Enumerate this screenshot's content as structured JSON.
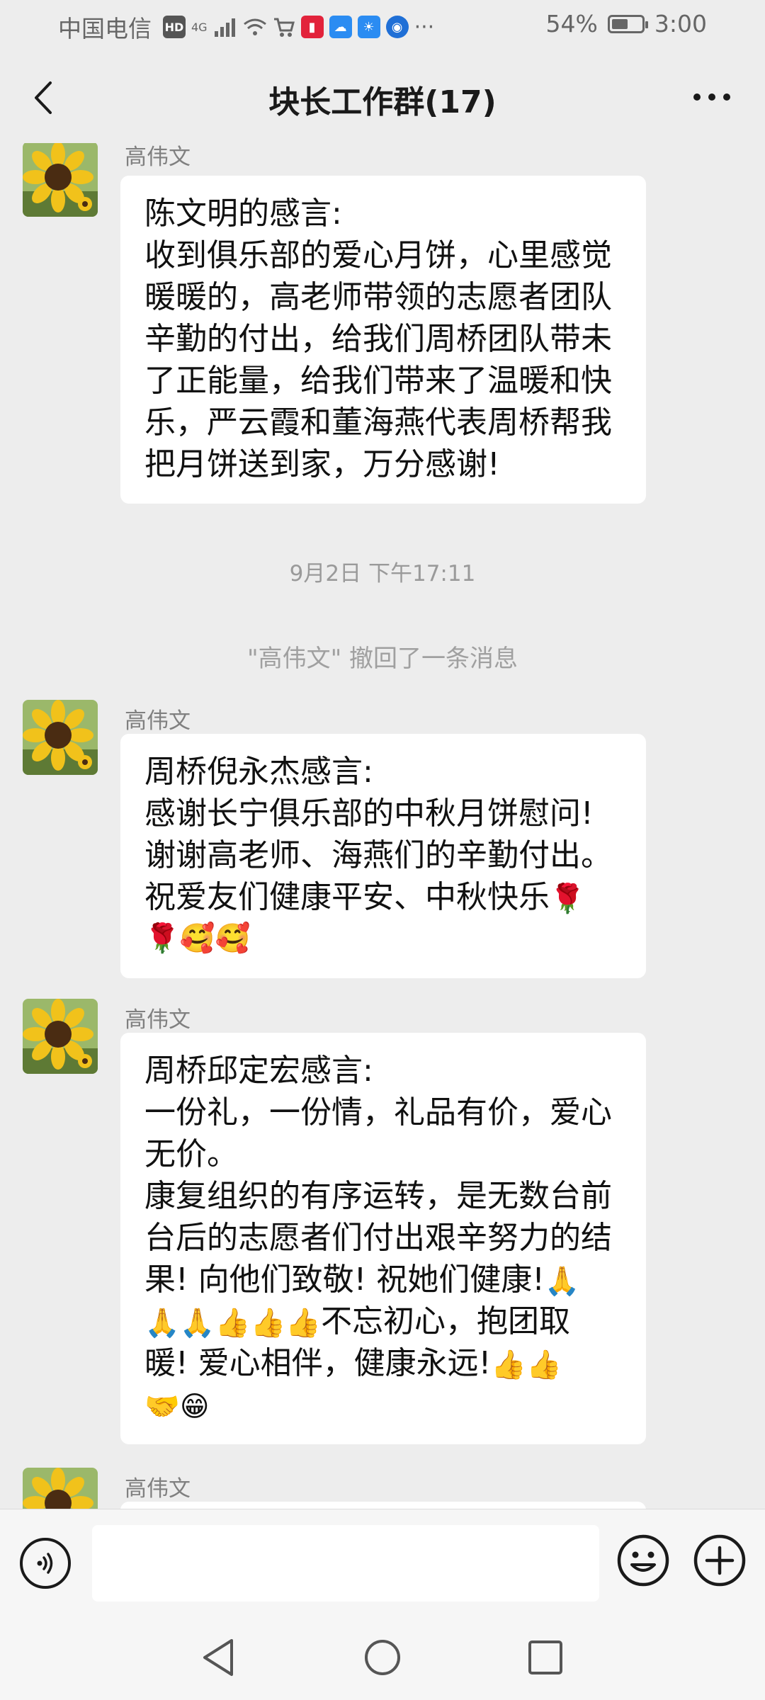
{
  "status_bar": {
    "carrier": "中国电信",
    "network": "4G",
    "more": "···",
    "battery_percent": "54%",
    "battery_level": 0.54,
    "time": "3:00"
  },
  "header": {
    "title": "块长工作群(17)"
  },
  "messages": [
    {
      "sender": "高伟文",
      "lines": [
        "陈文明的感言:",
        "收到俱乐部的爱心月饼，心里感觉",
        "暖暖的，高老师带领的志愿者团队",
        "辛勤的付出，给我们周桥团队带未",
        "了正能量，给我们带来了温暖和快",
        "乐，严云霞和董海燕代表周桥帮我",
        "把月饼送到家，万分感谢!"
      ]
    },
    {
      "sender": "高伟文",
      "lines": [
        "周桥倪永杰感言:",
        "感谢长宁俱乐部的中秋月饼慰问!",
        "谢谢高老师、海燕们的辛勤付出。",
        "祝爱友们健康平安、中秋快乐"
      ],
      "emoji_line": "🌹🥰🥰"
    },
    {
      "sender": "高伟文",
      "lines": [
        "周桥邱定宏感言:",
        "一份礼，一份情，礼品有价，爱心",
        "无价。",
        "康复组织的有序运转，是无数台前",
        "台后的志愿者们付出艰辛努力的结",
        "果! 向他们致敬! 祝她们健康!"
      ],
      "line7_text": "不忘初心，抱团取",
      "line8_text": "暖! 爱心相伴，健康永远!"
    },
    {
      "sender": "高伟文"
    }
  ],
  "timestamp": "9月2日 下午17:11",
  "recall_notice": "\"高伟文\" 撤回了一条消息",
  "icons": {
    "back": "chevron-left-icon",
    "more": "more-dots-icon",
    "voice": "voice-icon",
    "emoji": "emoji-smile-icon",
    "plus": "plus-icon"
  }
}
